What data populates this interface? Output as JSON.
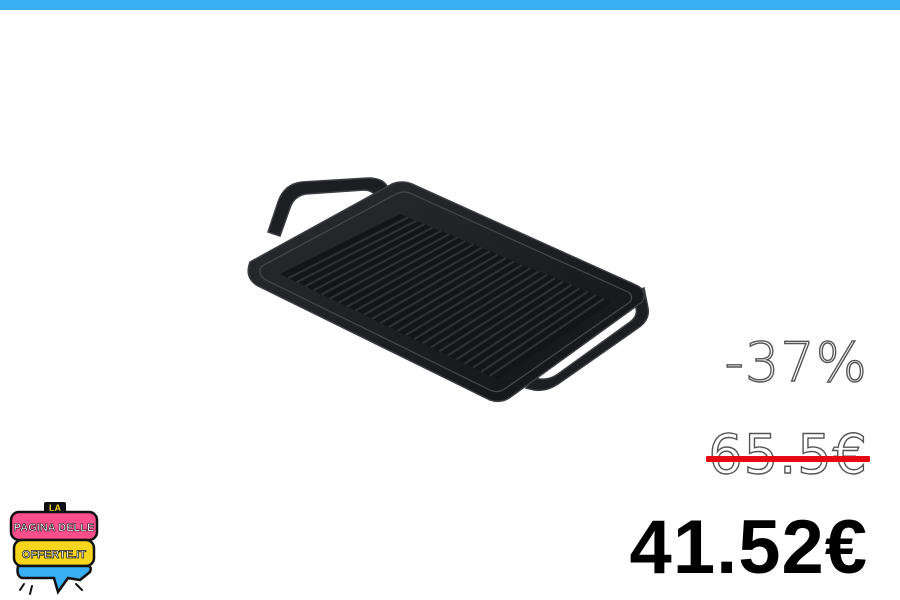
{
  "colors": {
    "top_bar": "#3aaef5",
    "strike": "#e50914",
    "price": "#000000"
  },
  "product": {
    "icon": "cast-iron-grill-pan"
  },
  "pricing": {
    "discount": "-37%",
    "old_price": "65.5€",
    "new_price": "41.52€"
  },
  "logo": {
    "line1": "LA",
    "line2": "PAGINA DELLE",
    "line3": "OFFERTE.IT"
  }
}
